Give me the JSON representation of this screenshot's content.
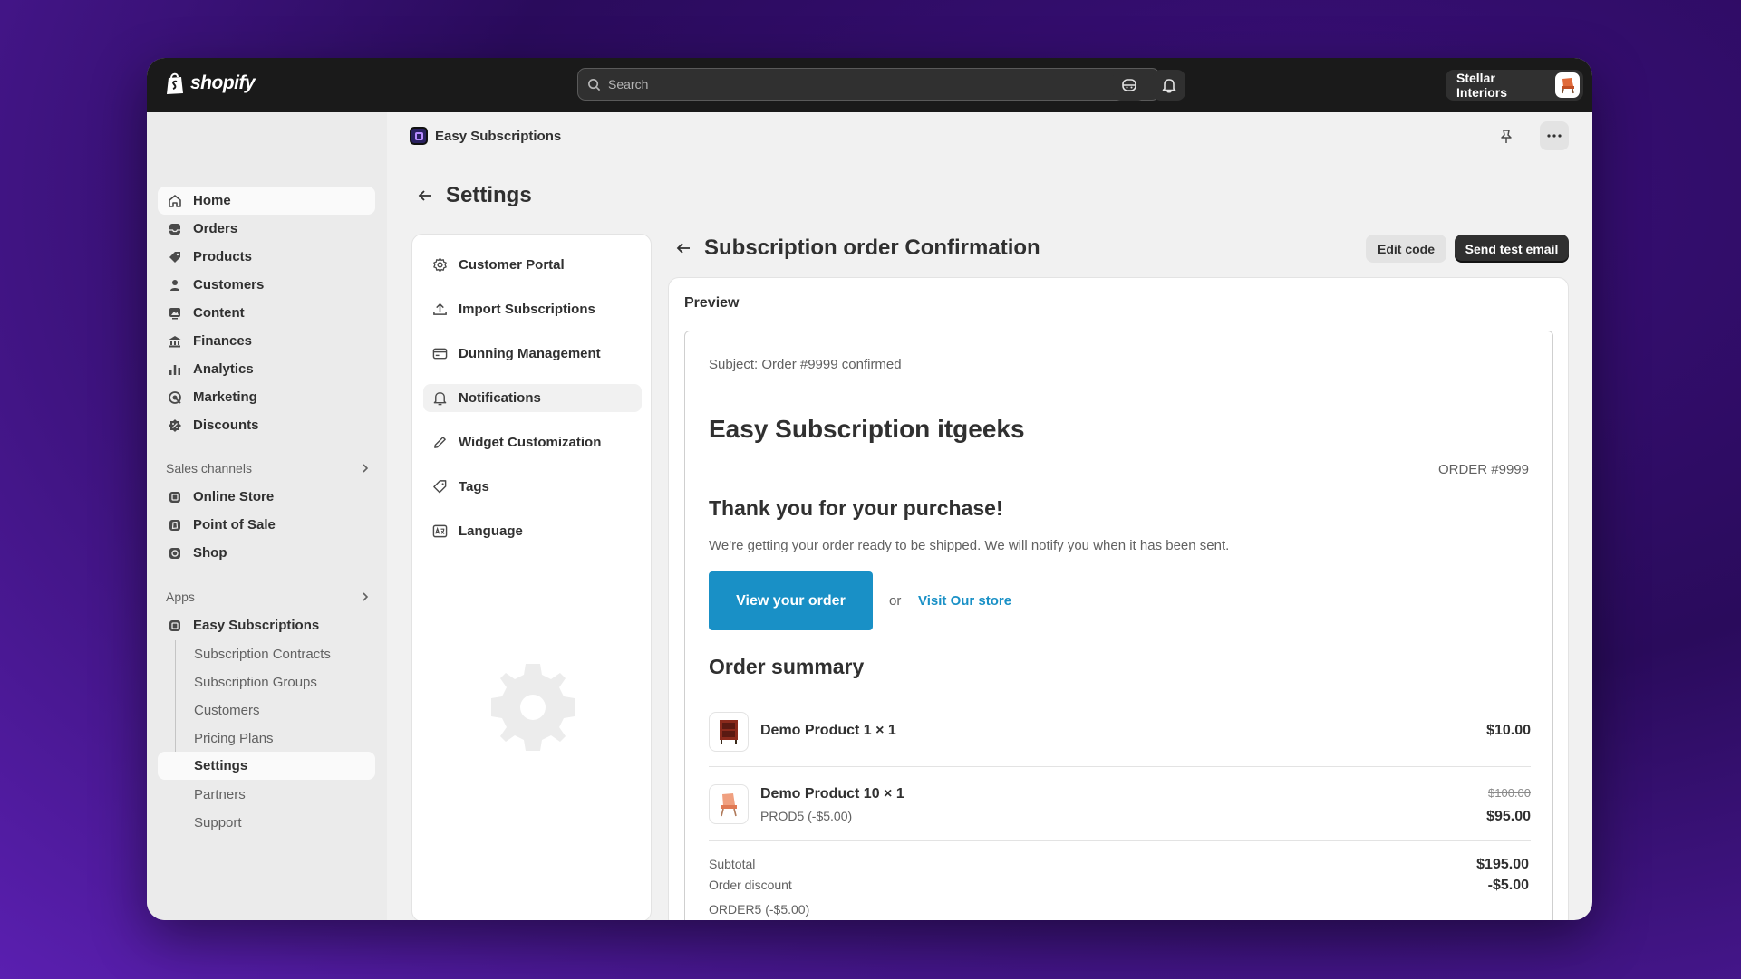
{
  "topbar": {
    "logo_text": "shopify",
    "search_placeholder": "Search",
    "store_name": "Stellar Interiors"
  },
  "sidebar": {
    "items": [
      {
        "label": "Home",
        "icon": "home-icon"
      },
      {
        "label": "Orders",
        "icon": "inbox-icon"
      },
      {
        "label": "Products",
        "icon": "tag-icon"
      },
      {
        "label": "Customers",
        "icon": "person-icon"
      },
      {
        "label": "Content",
        "icon": "image-icon"
      },
      {
        "label": "Finances",
        "icon": "bank-icon"
      },
      {
        "label": "Analytics",
        "icon": "bar-chart-icon"
      },
      {
        "label": "Marketing",
        "icon": "target-icon"
      },
      {
        "label": "Discounts",
        "icon": "discount-icon"
      }
    ],
    "sales_channels_label": "Sales channels",
    "channels": [
      {
        "label": "Online Store"
      },
      {
        "label": "Point of Sale"
      },
      {
        "label": "Shop"
      }
    ],
    "apps_label": "Apps",
    "app_name": "Easy Subscriptions",
    "app_subitems": [
      "Subscription Contracts",
      "Subscription Groups",
      "Customers",
      "Pricing Plans",
      "Settings",
      "Partners",
      "Support"
    ]
  },
  "app_header": {
    "title": "Easy Subscriptions"
  },
  "page": {
    "title": "Settings"
  },
  "settings_menu": [
    {
      "label": "Customer Portal"
    },
    {
      "label": "Import Subscriptions"
    },
    {
      "label": "Dunning Management"
    },
    {
      "label": "Notifications"
    },
    {
      "label": "Widget Customization"
    },
    {
      "label": "Tags"
    },
    {
      "label": "Language"
    }
  ],
  "detail": {
    "title": "Subscription order Confirmation",
    "edit_label": "Edit code",
    "send_label": "Send test email",
    "preview_label": "Preview"
  },
  "email": {
    "subject": "Subject: Order #9999 confirmed",
    "store_name": "Easy Subscription itgeeks",
    "order_no": "ORDER #9999",
    "thanks": "Thank you for your purchase!",
    "notice": "We're getting your order ready to be shipped. We will notify you when it has been sent.",
    "view_button": "View your order",
    "or_text": "or",
    "visit_link": "Visit Our store",
    "summary_title": "Order summary",
    "items": [
      {
        "name": "Demo Product 1 × 1",
        "price": "$10.00"
      },
      {
        "name": "Demo Product 10 × 1",
        "code": "PROD5 (-$5.00)",
        "original_price": "$100.00",
        "price": "$95.00"
      }
    ],
    "subtotal_label": "Subtotal",
    "subtotal_value": "$195.00",
    "discount_label": "Order discount",
    "discount_value": "-$5.00",
    "discount_code": "ORDER5 (-$5.00)"
  }
}
